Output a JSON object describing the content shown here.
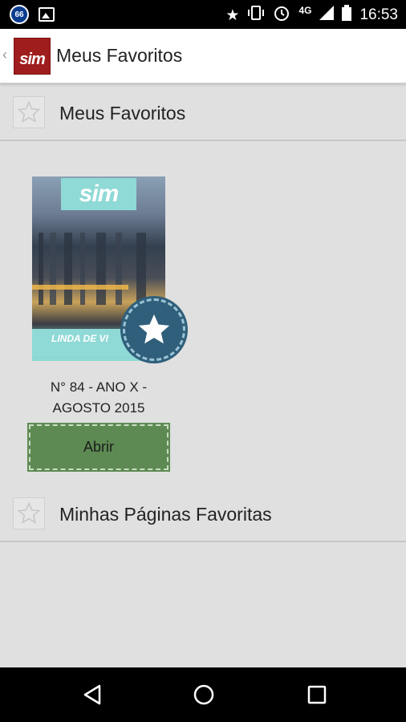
{
  "status_bar": {
    "notification_badge": "66",
    "network": "4G",
    "time": "16:53"
  },
  "app_bar": {
    "logo_text": "sim",
    "title": "Meus Favoritos"
  },
  "sections": {
    "favorites_header": "Meus Favoritos",
    "favorite_pages_header": "Minhas Páginas Favoritas"
  },
  "magazine": {
    "masthead": "sim",
    "cover_headline": "LINDA DE VI",
    "issue_line1": "N° 84 - ANO X -",
    "issue_line2": "AGOSTO 2015",
    "open_label": "Abrir"
  },
  "colors": {
    "logo_red": "#a01d1d",
    "button_green": "#5d8a52",
    "badge_blue": "#2f5f7a",
    "masthead_teal": "#8fd9d6"
  },
  "icons": {
    "star_outline": "star-outline-icon",
    "favorite_badge": "star-badge-icon"
  }
}
